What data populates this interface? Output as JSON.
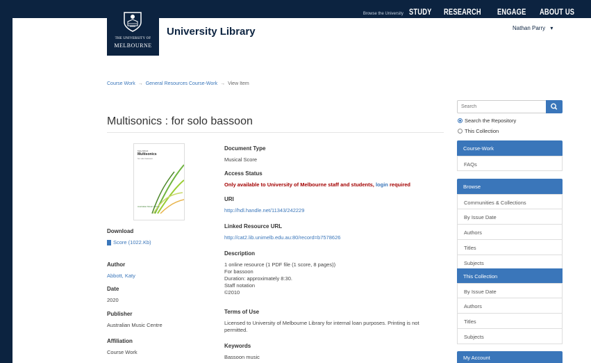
{
  "topnav": {
    "browse": "Browse the University",
    "study": "STUDY",
    "research": "RESEARCH",
    "engage": "ENGAGE",
    "about": "ABOUT US"
  },
  "logo": {
    "line1": "THE UNIVERSITY OF",
    "line2": "MELBOURNE"
  },
  "site_title": "University Library",
  "user": {
    "name": "Nathan Parry",
    "caret": "▾"
  },
  "breadcrumb": {
    "items": [
      "Course Work",
      "General Resources Course-Work",
      "View Item"
    ],
    "sep": "→"
  },
  "item": {
    "title": "Multisonics : for solo bassoon",
    "thumbnail": {
      "author": "Katy Abbott",
      "title": "Multisonics",
      "subtitle": "for solo bassoon",
      "publisher": "Australian Music Centre"
    }
  },
  "left_meta": {
    "download_label": "Download",
    "download_link": "Score (1022.Kb)",
    "author_label": "Author",
    "author": "Abbott, Katy",
    "date_label": "Date",
    "date": "2020",
    "publisher_label": "Publisher",
    "publisher": "Australian Music Centre",
    "affiliation_label": "Affiliation",
    "affiliation": "Course Work"
  },
  "right_meta": {
    "doctype_label": "Document Type",
    "doctype": "Musical Score",
    "access_label": "Access Status",
    "access_text": "Only available to University of Melbourne staff and students,",
    "access_login": "login",
    "access_required": "required",
    "uri_label": "URI",
    "uri": "http://hdl.handle.net/11343/242229",
    "linked_label": "Linked Resource URL",
    "linked": "http://cat2.lib.unimelb.edu.au:80/record=b7578626",
    "desc_label": "Description",
    "desc_lines": [
      "1 online resource (1 PDF file (1 score, 8 pages))",
      "For bassoon",
      "Duration: approximately 8:30.",
      "Staff notation",
      "©2010"
    ],
    "terms_label": "Terms of Use",
    "terms_line1": "Licensed to University of Melbourne Library for internal loan purposes. Printing is not",
    "terms_line2": "permitted.",
    "keywords_label": "Keywords",
    "keyword": "Bassoon music"
  },
  "sidebar": {
    "search_placeholder": "Search",
    "radio_repo": "Search the Repository",
    "radio_collection": "This Collection",
    "coursework_head": "Course-Work",
    "faqs": "FAQs",
    "browse_head": "Browse",
    "browse_items": [
      "Communities & Collections",
      "By Issue Date",
      "Authors",
      "Titles",
      "Subjects"
    ],
    "collection_head": "This Collection",
    "collection_items": [
      "By Issue Date",
      "Authors",
      "Titles",
      "Subjects"
    ],
    "account_head": "My Account"
  },
  "colors": {
    "navy": "#0c2340",
    "link": "#3a76ba",
    "alert": "#a30000"
  }
}
